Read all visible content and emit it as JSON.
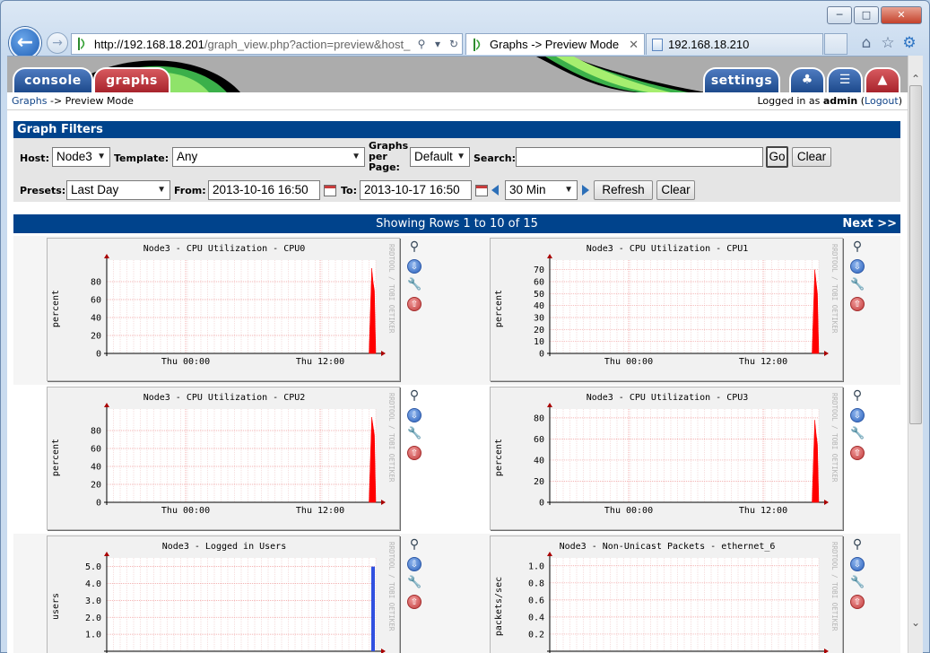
{
  "browser": {
    "url_host": "http://192.168.18.201",
    "url_rest": "/graph_view.php?action=preview&host_",
    "tabs": [
      {
        "label": "Graphs -> Preview Mode",
        "active": true
      },
      {
        "label": "192.168.18.210",
        "active": false
      }
    ]
  },
  "cacti": {
    "tabs": {
      "console": "console",
      "graphs": "graphs",
      "settings": "settings"
    },
    "breadcrumb": {
      "link": "Graphs",
      "rest": " -> Preview Mode"
    },
    "login": {
      "prefix": "Logged in as ",
      "user": "admin",
      "logout": "Logout"
    }
  },
  "filters": {
    "title": "Graph Filters",
    "host_label": "Host:",
    "host_value": "Node3",
    "template_label": "Template:",
    "template_value": "Any",
    "gpp_label_1": "Graphs",
    "gpp_label_2": "per",
    "gpp_label_3": "Page:",
    "gpp_value": "Default",
    "search_label": "Search:",
    "search_value": "",
    "go": "Go",
    "clear": "Clear",
    "presets_label": "Presets:",
    "presets_value": "Last Day",
    "from_label": "From:",
    "from_value": "2013-10-16 16:50",
    "to_label": "To:",
    "to_value": "2013-10-17 16:50",
    "shift_value": "30 Min",
    "refresh": "Refresh",
    "clear2": "Clear"
  },
  "results": {
    "showing": "Showing Rows 1 to 10 of 15",
    "next": "Next >>"
  },
  "watermark": "RRDTOOL / TOBI OETIKER",
  "chart_data": [
    {
      "type": "area",
      "title": "Node3 - CPU Utilization - CPU0",
      "ylabel": "percent",
      "xticks": [
        "Thu 00:00",
        "Thu 12:00"
      ],
      "yticks": [
        0,
        20,
        40,
        60,
        80
      ],
      "ylim": [
        0,
        100
      ],
      "color": "#ff0000",
      "x": [
        0.975,
        0.985,
        0.99,
        0.995,
        1.0
      ],
      "values": [
        0,
        95,
        80,
        70,
        0
      ]
    },
    {
      "type": "area",
      "title": "Node3 - CPU Utilization - CPU1",
      "ylabel": "percent",
      "xticks": [
        "Thu 00:00",
        "Thu 12:00"
      ],
      "yticks": [
        0,
        10,
        20,
        30,
        40,
        50,
        60,
        70
      ],
      "ylim": [
        0,
        75
      ],
      "color": "#ff0000",
      "x": [
        0.975,
        0.985,
        0.99,
        0.995,
        1.0
      ],
      "values": [
        0,
        70,
        60,
        50,
        0
      ]
    },
    {
      "type": "area",
      "title": "Node3 - CPU Utilization - CPU2",
      "ylabel": "percent",
      "xticks": [
        "Thu 00:00",
        "Thu 12:00"
      ],
      "yticks": [
        0,
        20,
        40,
        60,
        80
      ],
      "ylim": [
        0,
        100
      ],
      "color": "#ff0000",
      "x": [
        0.975,
        0.985,
        0.99,
        0.995,
        1.0
      ],
      "values": [
        0,
        95,
        85,
        75,
        0
      ]
    },
    {
      "type": "area",
      "title": "Node3 - CPU Utilization - CPU3",
      "ylabel": "percent",
      "xticks": [
        "Thu 00:00",
        "Thu 12:00"
      ],
      "yticks": [
        0,
        20,
        40,
        60,
        80
      ],
      "ylim": [
        0,
        85
      ],
      "color": "#ff0000",
      "x": [
        0.975,
        0.985,
        0.99,
        0.995,
        1.0
      ],
      "values": [
        0,
        78,
        65,
        55,
        0
      ]
    },
    {
      "type": "bar",
      "title": "Node3 - Logged in Users",
      "ylabel": "users",
      "xticks": [],
      "yticks": [
        "1.0",
        "2.0",
        "3.0",
        "4.0",
        "5.0"
      ],
      "ytick_values": [
        1,
        2,
        3,
        4,
        5
      ],
      "ylim": [
        0,
        5.3
      ],
      "color": "#3050e0",
      "x": [
        0.99
      ],
      "values": [
        5
      ]
    },
    {
      "type": "line",
      "title": "Node3 - Non-Unicast Packets - ethernet_6",
      "ylabel": "packets/sec",
      "xticks": [],
      "yticks": [
        "0.2",
        "0.4",
        "0.6",
        "0.8",
        "1.0"
      ],
      "ytick_values": [
        0.2,
        0.4,
        0.6,
        0.8,
        1.0
      ],
      "ylim": [
        0,
        1.05
      ],
      "color": "#ff0000",
      "x": [],
      "values": []
    }
  ]
}
